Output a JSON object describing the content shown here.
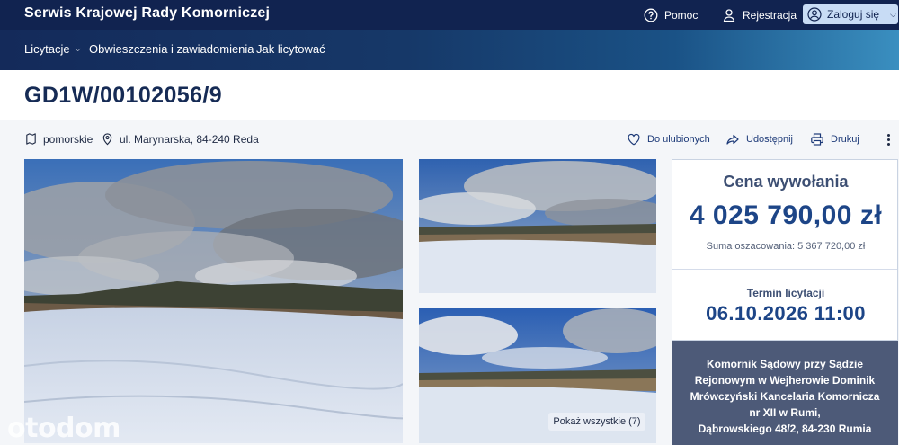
{
  "header": {
    "site_title": "Serwis Krajowej Rady Komorniczej",
    "help_label": "Pomoc",
    "register_label": "Rejestracja",
    "login_label": "Zaloguj się"
  },
  "nav": {
    "items": [
      {
        "label": "Licytacje"
      },
      {
        "label": "Obwieszczenia i zawiadomienia"
      },
      {
        "label": "Jak licytować"
      }
    ]
  },
  "listing": {
    "title": "GD1W/00102056/9",
    "region": "pomorskie",
    "address": "ul. Marynarska, 84-240 Reda",
    "favorite_label": "Do ulubionych",
    "share_label": "Udostępnij",
    "print_label": "Drukuj",
    "show_all_label": "Pokaż wszystkie (7)",
    "watermark": "otodom"
  },
  "price_card": {
    "label": "Cena wywołania",
    "value": "4 025 790,00 zł",
    "estimate": "Suma oszacowania: 5 367 720,00 zł",
    "term_label": "Termin licytacji",
    "term_value": "06.10.2026 11:00"
  },
  "bailiff": {
    "lines": [
      "Komornik Sądowy przy Sądzie",
      "Rejonowym w Wejherowie Dominik",
      "Mrówczyński Kancelaria Komornicza",
      "nr XII w Rumi,",
      "Dąbrowskiego 48/2, 84-230 Rumia"
    ]
  },
  "icons": {
    "help": "question-circle-icon",
    "register": "user-icon",
    "login": "user-circle-icon",
    "region": "map-region-icon",
    "address": "location-pin-icon",
    "favorite": "heart-icon",
    "share": "share-icon",
    "print": "printer-icon",
    "more": "more-vertical-icon"
  },
  "colors": {
    "topbar": "#112350",
    "accent": "#1d4587",
    "bailiff_bg": "#4d5a78"
  }
}
